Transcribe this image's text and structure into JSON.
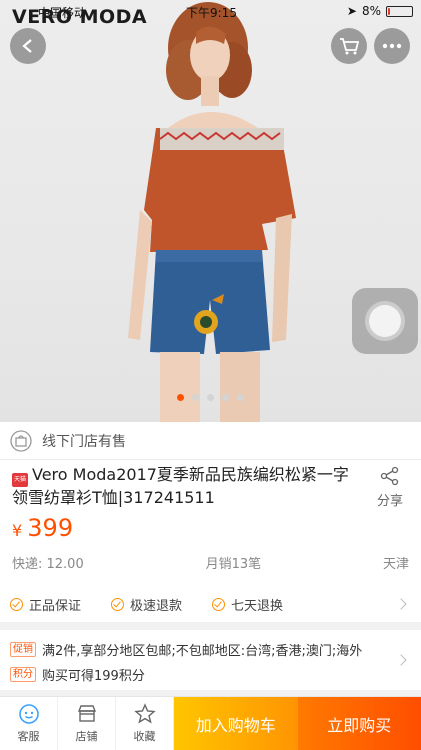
{
  "status": {
    "carrier": "中国移动",
    "time": "下午9:15",
    "battery": "8%",
    "battery_level": 0.08
  },
  "brand": "VERO MODA",
  "gallery": {
    "total_images": 5,
    "active_index": 0
  },
  "offline_store": "线下门店有售",
  "product": {
    "title": "Vero Moda2017夏季新品民族编织松紧一字领雪纺罩衫T恤|317241511",
    "share_label": "分享",
    "price_currency": "¥",
    "price": "399",
    "shipping": "快递: 12.00",
    "monthly_sales": "月销13笔",
    "location": "天津"
  },
  "services": [
    "正品保证",
    "极速退款",
    "七天退换"
  ],
  "promotions": [
    {
      "tag": "促销",
      "text": "满2件,享部分地区包邮;不包邮地区:台湾;香港;澳门;海外"
    },
    {
      "tag": "积分",
      "text": "购买可得199积分"
    }
  ],
  "bottom_nav": {
    "service": "客服",
    "shop": "店铺",
    "favorite": "收藏",
    "add_to_cart": "加入购物车",
    "buy_now": "立即购买"
  },
  "colors": {
    "accent": "#ff5000",
    "cart_button": "#ffa000",
    "buy_button": "#ff5000"
  }
}
